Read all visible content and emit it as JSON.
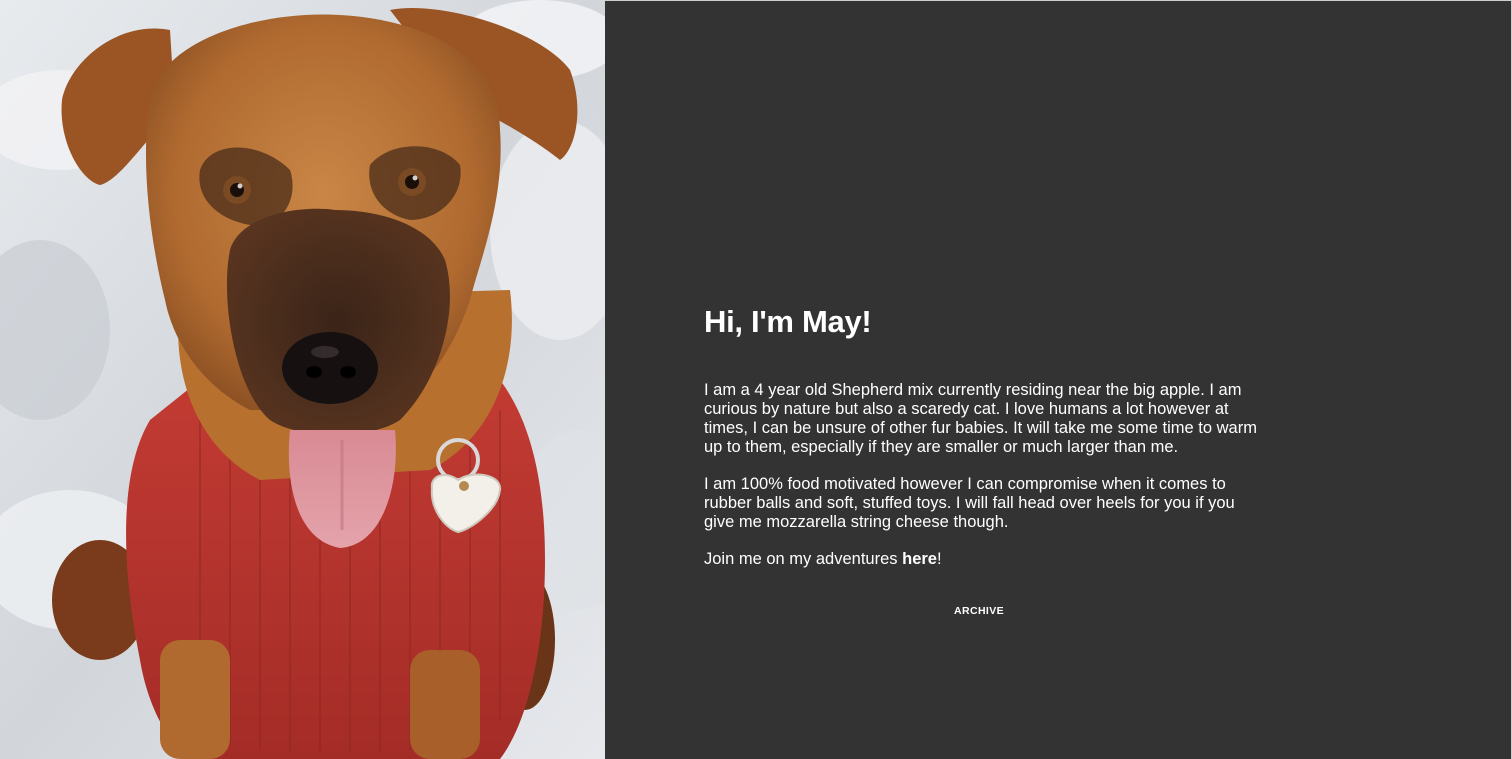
{
  "profile": {
    "heading": "Hi, I'm May!",
    "paragraph_1": "I am a 4 year old Shepherd mix currently residing near the big apple. I am curious by nature but also a scaredy cat. I love humans a lot however at times, I can be unsure of other fur babies. It will take me some time to warm up to them, especially if they are smaller or much larger than me.",
    "paragraph_2": "I am 100% food motivated however I can compromise when it comes to rubber balls and soft, stuffed toys. I will fall head over heels for you if you give me mozzarella string cheese though.",
    "paragraph_3_prefix": "Join me on my adventures ",
    "paragraph_3_link": "here",
    "paragraph_3_suffix": "!"
  },
  "nav": {
    "archive_label": "ARCHIVE"
  },
  "colors": {
    "background": "#333333",
    "text": "#ffffff",
    "sweater": "#b8332c",
    "fur": "#c07a3c"
  }
}
